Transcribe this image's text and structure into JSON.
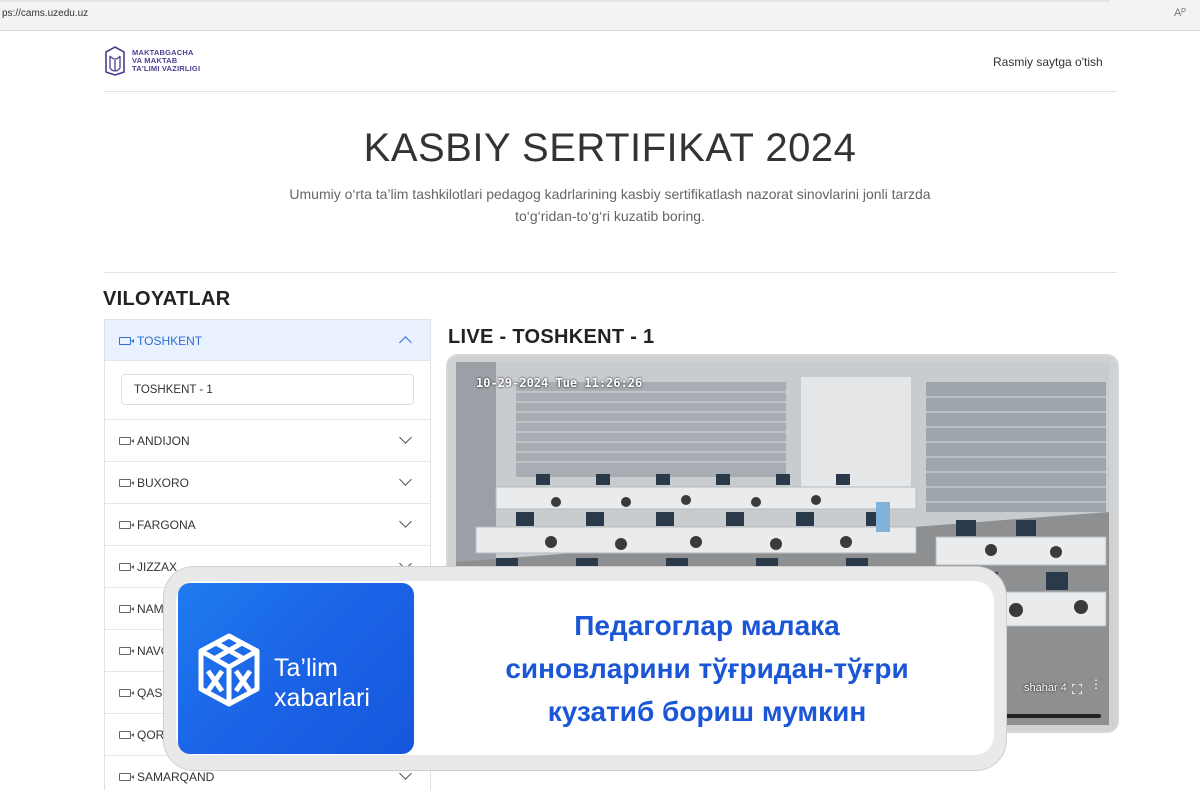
{
  "browser": {
    "url": "ps://cams.uzedu.uz",
    "reader_label": "Aᴾ"
  },
  "header": {
    "logo_lines": [
      "MAKTABGACHA",
      "VA MAKTAB",
      "TA'LIMI VAZIRLIGI"
    ],
    "official_link": "Rasmiy saytga o'tish"
  },
  "hero": {
    "title": "KASBIY SERTIFIKAT 2024",
    "subtitle_line1": "Umumiy o‘rta ta’lim tashkilotlari pedagog kadrlarining kasbiy sertifikatlash nazorat sinovlarini jonli tarzda",
    "subtitle_line2": "to‘g‘ridan-to‘g‘ri kuzatib boring."
  },
  "regions": {
    "heading": "VILOYATLAR",
    "active": {
      "label": "TOSHKENT",
      "cameras": [
        "TOSHKENT - 1"
      ]
    },
    "items": [
      {
        "label": "ANDIJON"
      },
      {
        "label": "BUXORO"
      },
      {
        "label": "FARGONA"
      },
      {
        "label": "JIZZAX"
      },
      {
        "label": "NAMANGAN"
      },
      {
        "label": "NAVOIY"
      },
      {
        "label": "QASHQADARYO"
      },
      {
        "label": "QORAQALPOG'ISTON"
      },
      {
        "label": "SAMARQAND"
      }
    ]
  },
  "live": {
    "title": "LIVE - TOSHKENT - 1",
    "timestamp": "10-29-2024 Tue 11:26:26",
    "camera_overlay": "shahar 4"
  },
  "banner": {
    "brand_line1": "Ta’lim",
    "brand_line2": "xabarlari",
    "headline_line1": "Педагоглар малака",
    "headline_line2": "синовларини тўғридан-тўғри",
    "headline_line3": "кузатиб бориш мумкин",
    "colors": {
      "brand": "#1b63e6",
      "headline": "#1a56d6"
    }
  }
}
